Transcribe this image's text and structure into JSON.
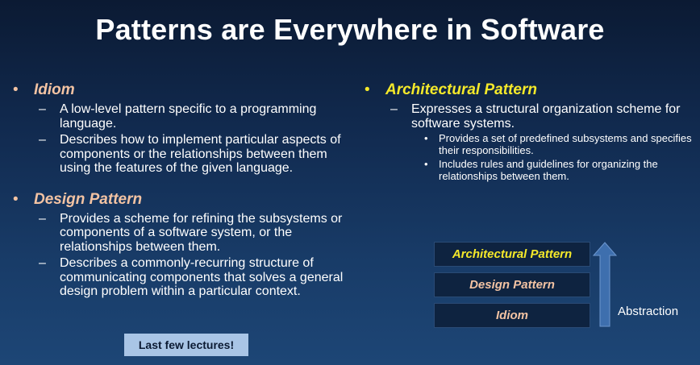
{
  "title": "Patterns are Everywhere in Software",
  "left": {
    "idiom": {
      "label": "Idiom",
      "items": [
        "A low-level pattern specific to a programming language.",
        "Describes how to implement particular aspects of components or the relationships between them using the features of the given language."
      ]
    },
    "design": {
      "label": "Design Pattern",
      "items": [
        "Provides a scheme for refining the subsystems or components of a software system, or the relationships between them.",
        "Describes a commonly-recurring structure of communicating components that solves a general design problem within a particular context."
      ]
    },
    "note": "Last few lectures!"
  },
  "right": {
    "arch": {
      "label": "Architectural Pattern",
      "item": "Expresses a structural organization scheme for software systems.",
      "subitems": [
        "Provides a set of predefined subsystems and specifies their responsibilities.",
        "Includes rules and guidelines for organizing the relationships between them."
      ]
    }
  },
  "diagram": {
    "levels": [
      "Architectural Pattern",
      "Design Pattern",
      "Idiom"
    ],
    "arrow_label": "Abstraction"
  },
  "colors": {
    "accent_yellow": "#f5e92a",
    "accent_peach": "#f3c3a3",
    "note_bg": "#a9c5e6",
    "arrow_fill": "#3e6fae"
  }
}
